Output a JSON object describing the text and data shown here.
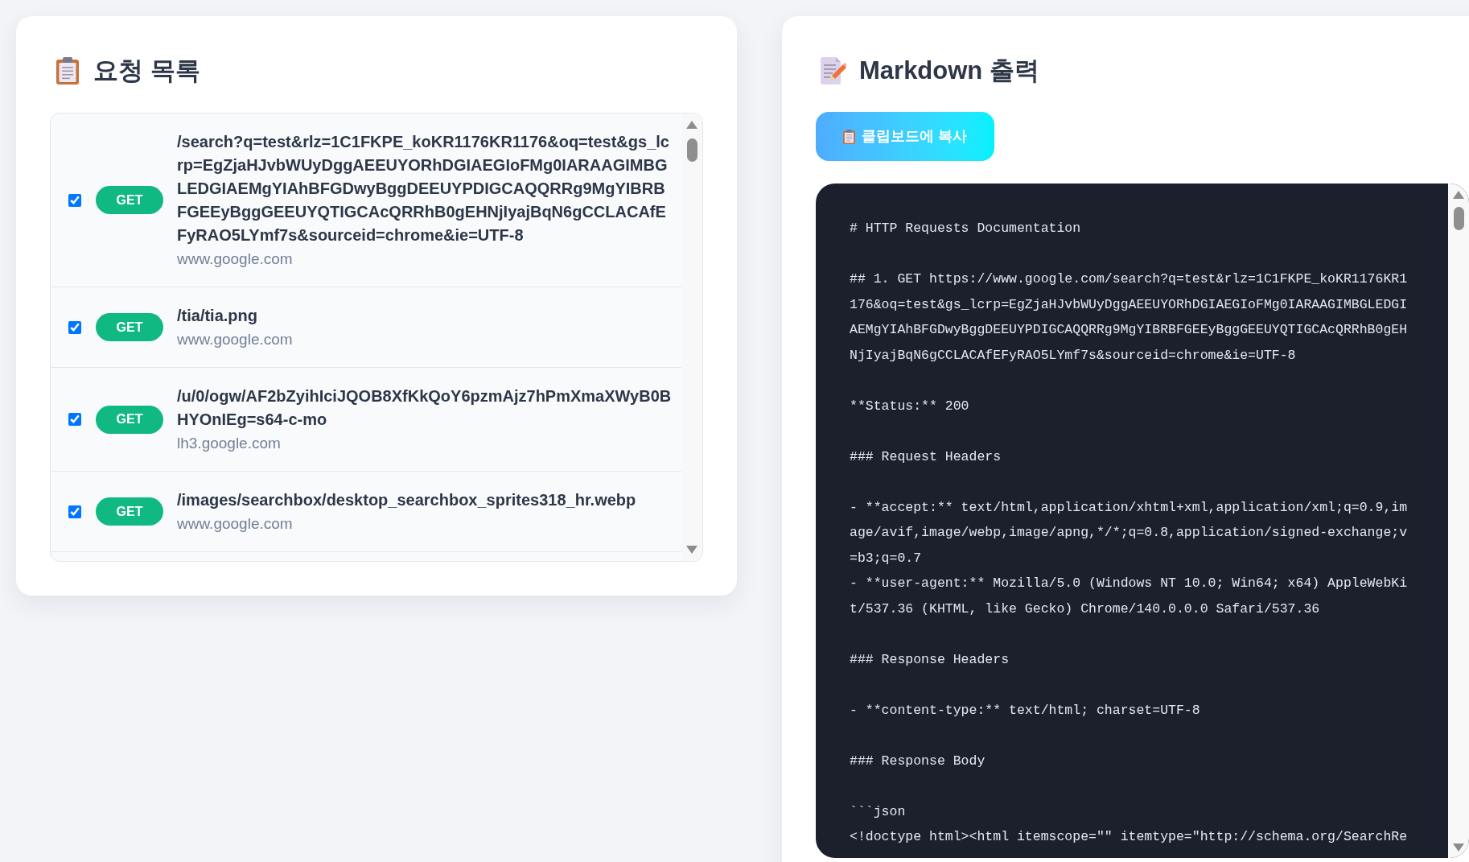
{
  "request_list": {
    "title": "요청 목록",
    "requests": [
      {
        "checked": true,
        "method": "GET",
        "path": "/search?q=test&rlz=1C1FKPE_koKR1176KR1176&oq=test&gs_lcrp=EgZjaHJvbWUyDggAEEUYORhDGIAEGIoFMg0IARAAGIMBGLEDGIAEMgYIAhBFGDwyBggDEEUYPDIGCAQQRRg9MgYIBRBFGEEyBggGEEUYQTIGCAcQRRhB0gEHNjIyajBqN6gCCLACAfEFyRAO5LYmf7s&sourceid=chrome&ie=UTF-8",
        "host": "www.google.com"
      },
      {
        "checked": true,
        "method": "GET",
        "path": "/tia/tia.png",
        "host": "www.google.com"
      },
      {
        "checked": true,
        "method": "GET",
        "path": "/u/0/ogw/AF2bZyihIciJQOB8XfKkQoY6pzmAjz7hPmXmaXWyB0BHYOnIEg=s64-c-mo",
        "host": "lh3.google.com"
      },
      {
        "checked": true,
        "method": "GET",
        "path": "/images/searchbox/desktop_searchbox_sprites318_hr.webp",
        "host": "www.google.com"
      }
    ]
  },
  "markdown_output": {
    "title": "Markdown 출력",
    "copy_button": "클립보드에 복사",
    "blocks": [
      [
        "# HTTP Requests Documentation"
      ],
      [
        "## 1. GET https://www.google.com/search?q=test&rlz=1C1FKPE_koKR1176KR1176&oq=test&gs_lcrp=EgZjaHJvbWUyDggAEEUYORhDGIAEGIoFMg0IARAAGIMBGLEDGIAEMgYIAhBFGDwyBggDEEUYPDIGCAQQRRg9MgYIBRBFGEEyBggGEEUYQTIGCAcQRRhB0gEHNjIyajBqN6gCCLACAfEFyRAO5LYmf7s&sourceid=chrome&ie=UTF-8"
      ],
      [
        "**Status:** 200"
      ],
      [
        "### Request Headers"
      ],
      [
        "- **accept:** text/html,application/xhtml+xml,application/xml;q=0.9,image/avif,image/webp,image/apng,*/*;q=0.8,application/signed-exchange;v=b3;q=0.7",
        "- **user-agent:** Mozilla/5.0 (Windows NT 10.0; Win64; x64) AppleWebKit/537.36 (KHTML, like Gecko) Chrome/140.0.0.0 Safari/537.36"
      ],
      [
        "### Response Headers"
      ],
      [
        "- **content-type:** text/html; charset=UTF-8"
      ],
      [
        "### Response Body"
      ],
      [
        "```json",
        "<!doctype html><html itemscope=\"\" itemtype=\"http://schema.org/SearchRe"
      ]
    ]
  }
}
